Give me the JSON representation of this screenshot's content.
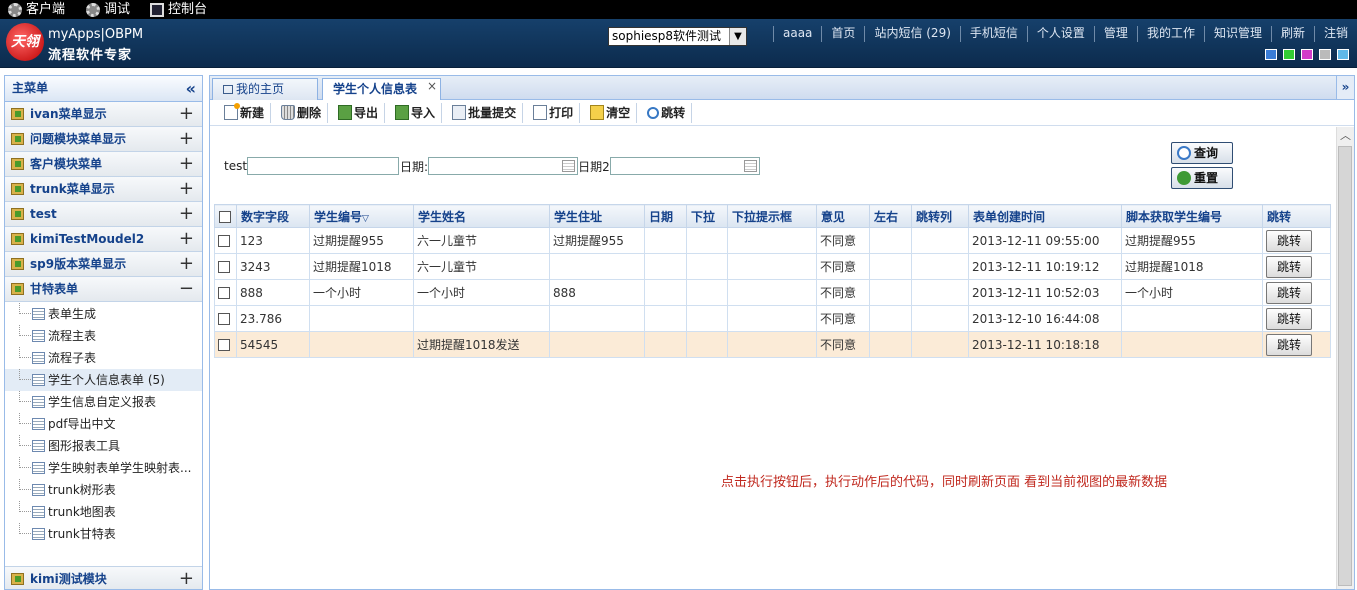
{
  "topbar": {
    "items": [
      {
        "label": "客户端",
        "icon": "gear-icon"
      },
      {
        "label": "调试",
        "icon": "gear-icon"
      },
      {
        "label": "控制台",
        "icon": "monitor-icon"
      }
    ]
  },
  "header": {
    "logo_text": "天翎",
    "brand_line1": "myApps|OBPM",
    "brand_line2": "流程软件专家",
    "workspace_select": "sophiesp8软件测试",
    "nav": [
      "aaaa",
      "首页",
      "站内短信 (29)",
      "手机短信",
      "个人设置",
      "管理",
      "我的工作",
      "知识管理",
      "刷新",
      "注销"
    ],
    "skin_colors": [
      "#3a7cd6",
      "#33cc33",
      "#d23cc9",
      "#bbbbbb",
      "#5fb8e8"
    ]
  },
  "sidebar": {
    "title": "主菜单",
    "collapse_icon": "double-chevron-left-icon",
    "menus": [
      {
        "label": "ivan菜单显示",
        "toggle": "+"
      },
      {
        "label": "问题模块菜单显示",
        "toggle": "+"
      },
      {
        "label": "客户模块菜单",
        "toggle": "+"
      },
      {
        "label": "trunk菜单显示",
        "toggle": "+"
      },
      {
        "label": "test",
        "toggle": "+"
      },
      {
        "label": "kimiTestMoudel2",
        "toggle": "+"
      },
      {
        "label": "sp9版本菜单显示",
        "toggle": "+"
      },
      {
        "label": "甘特表单",
        "toggle": "−"
      }
    ],
    "sub_items": [
      {
        "label": "表单生成"
      },
      {
        "label": "流程主表"
      },
      {
        "label": "流程子表"
      },
      {
        "label": "学生个人信息表单 (5)",
        "active": true
      },
      {
        "label": "学生信息自定义报表"
      },
      {
        "label": "pdf导出中文"
      },
      {
        "label": "图形报表工具"
      },
      {
        "label": "学生映射表单学生映射表..."
      },
      {
        "label": "trunk树形表"
      },
      {
        "label": "trunk地图表"
      },
      {
        "label": "trunk甘特表"
      }
    ],
    "bottom_menu": {
      "label": "kimi测试模块",
      "toggle": "+"
    }
  },
  "tabs": [
    {
      "label": "我的主页",
      "active": false
    },
    {
      "label": "学生个人信息表",
      "active": true,
      "close": "×"
    }
  ],
  "tabs_menu_icon": "double-chevron-down-icon",
  "toolbar": {
    "buttons": [
      {
        "label": "新建",
        "icon": "new-doc-icon"
      },
      {
        "label": "删除",
        "icon": "trash-icon"
      },
      {
        "label": "导出",
        "icon": "export-icon"
      },
      {
        "label": "导入",
        "icon": "import-icon"
      },
      {
        "label": "批量提交",
        "icon": "batch-submit-icon"
      },
      {
        "label": "打印",
        "icon": "print-icon"
      },
      {
        "label": "清空",
        "icon": "clear-icon"
      },
      {
        "label": "跳转",
        "icon": "jump-icon"
      }
    ]
  },
  "search": {
    "field1_label": "test",
    "field1_value": "",
    "date_label": "日期:",
    "date_value": "",
    "date2_label": "日期2",
    "date2_value": "",
    "query_label": "查询",
    "reset_label": "重置"
  },
  "grid": {
    "columns": [
      "数字字段",
      "学生编号",
      "学生姓名",
      "学生住址",
      "日期",
      "下拉",
      "下拉提示框",
      "意见",
      "左右",
      "跳转列",
      "表单创建时间",
      "脚本获取学生编号",
      "跳转"
    ],
    "sort_indicator": "▽",
    "rows": [
      {
        "num": "123",
        "sid": "过期提醒955",
        "name": "六一儿童节",
        "addr": "过期提醒955",
        "date": "",
        "dd": "",
        "ddtip": "",
        "opinion": "不同意",
        "lr": "",
        "jcol": "",
        "created": "2013-12-11 09:55:00",
        "script_sid": "过期提醒955",
        "btn": "跳转"
      },
      {
        "num": "3243",
        "sid": "过期提醒1018",
        "name": "六一儿童节",
        "addr": "",
        "date": "",
        "dd": "",
        "ddtip": "",
        "opinion": "不同意",
        "lr": "",
        "jcol": "",
        "created": "2013-12-11 10:19:12",
        "script_sid": "过期提醒1018",
        "btn": "跳转"
      },
      {
        "num": "888",
        "sid": "一个小时",
        "name": "一个小时",
        "addr": "888",
        "date": "",
        "dd": "",
        "ddtip": "",
        "opinion": "不同意",
        "lr": "",
        "jcol": "",
        "created": "2013-12-11 10:52:03",
        "script_sid": "一个小时",
        "btn": "跳转"
      },
      {
        "num": "23.786",
        "sid": "",
        "name": "",
        "addr": "",
        "date": "",
        "dd": "",
        "ddtip": "",
        "opinion": "不同意",
        "lr": "",
        "jcol": "",
        "created": "2013-12-10 16:44:08",
        "script_sid": "",
        "btn": "跳转"
      },
      {
        "num": "54545",
        "sid": "",
        "name": "过期提醒1018发送",
        "addr": "",
        "date": "",
        "dd": "",
        "ddtip": "",
        "opinion": "不同意",
        "lr": "",
        "jcol": "",
        "created": "2013-12-11 10:18:18",
        "script_sid": "",
        "btn": "跳转",
        "highlight": true
      }
    ]
  },
  "notice": "点击执行按钮后，执行动作后的代码，同时刷新页面 看到当前视图的最新数据"
}
